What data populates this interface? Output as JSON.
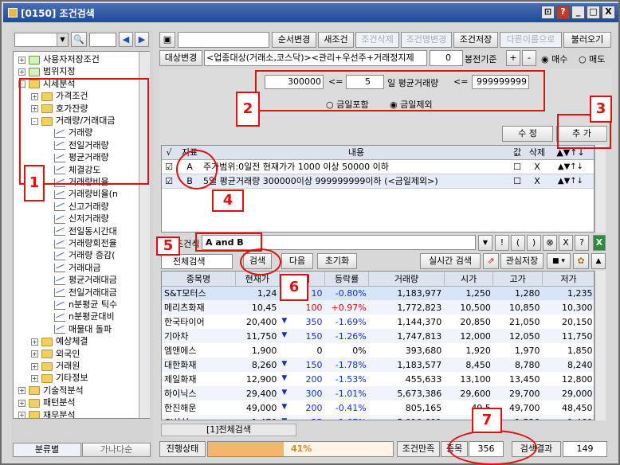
{
  "window": {
    "title": "[0150] 조건검색"
  },
  "left": {
    "search_placeholder": "",
    "tree": [
      {
        "label": "사용자저장조건"
      },
      {
        "label": "범위지정"
      },
      {
        "label": "시세분석"
      },
      {
        "label": "가격조건"
      },
      {
        "label": "호가잔량"
      },
      {
        "label": "거래량/거래대금"
      },
      {
        "label": "거래량"
      },
      {
        "label": "전일거래량"
      },
      {
        "label": "평균거래량"
      },
      {
        "label": "체결강도"
      },
      {
        "label": "거래량비율"
      },
      {
        "label": "거래량비율(n"
      },
      {
        "label": "신고거래량"
      },
      {
        "label": "신저거래량"
      },
      {
        "label": "전일동시간대"
      },
      {
        "label": "거래량회전율"
      },
      {
        "label": "거래량 증감("
      },
      {
        "label": "거래대금"
      },
      {
        "label": "평균거래대금"
      },
      {
        "label": "전일거래대금"
      },
      {
        "label": "n분평균 틱수"
      },
      {
        "label": "n분평균대비"
      },
      {
        "label": "매물대 돌파"
      },
      {
        "label": "예상체결"
      },
      {
        "label": "외국인"
      },
      {
        "label": "거래원"
      },
      {
        "label": "기타정보"
      },
      {
        "label": "기술적분석"
      },
      {
        "label": "패턴분석"
      },
      {
        "label": "재무분석"
      }
    ],
    "tab_category": "분류별",
    "tab_alpha": "가나다순"
  },
  "toolbar": {
    "save_change": "순서변경",
    "new_cond": "새조건",
    "cond_delete": "조건삭제",
    "name_change": "조건명변경",
    "cond_save": "조건저장",
    "save_as": "다른이름으로",
    "load": "불러오기"
  },
  "target": {
    "label": "대상변경",
    "value": "<업종대상(거래소,코스닥)><관리+우선주+거래정지제",
    "bong_value": "0",
    "bong_label": "봉전기준",
    "plus": "+",
    "minus": "-",
    "buy": "매수",
    "sell": "매도"
  },
  "condition": {
    "min_value": "300000",
    "op1": "<=",
    "days": "5",
    "days_label": "일 평균거래량",
    "op2": "<=",
    "max_value": "999999999",
    "radio_include": "금일포함",
    "radio_exclude": "금일제외",
    "edit_btn": "수  정",
    "add_btn": "추  가"
  },
  "cond_table": {
    "headers": {
      "check": "√",
      "index": "지표",
      "content": "내용",
      "value": "값",
      "delete": "삭제"
    },
    "rows": [
      {
        "idx": "A",
        "text": "주가범위:0일전 현재가가 1000 이상 50000 이하",
        "del": "X"
      },
      {
        "idx": "B",
        "text": "5일 평균거래량 300000이상 999999999이하 (<금일제외>)",
        "del": "X"
      }
    ]
  },
  "logic": {
    "label": "조건식",
    "expr": "A and B",
    "ops": [
      "!",
      "(",
      ")",
      "⊗",
      "X",
      "?"
    ]
  },
  "search_bar": {
    "scope": "전체검색",
    "search": "검색",
    "next": "다음",
    "reset": "초기화",
    "realtime": "실시간 검색",
    "watch_save": "관심저장"
  },
  "results": {
    "headers": [
      "종목명",
      "현재가",
      "대비",
      "등락률",
      "거래량",
      "시가",
      "고가",
      "저가"
    ],
    "rows": [
      {
        "name": "S&T모터스",
        "price": "1,24",
        "sign": "",
        "chg": "10",
        "rate": "-0.80%",
        "vol": "1,183,977",
        "open": "1,250",
        "high": "1,280",
        "low": "1,235",
        "dir": "dn"
      },
      {
        "name": "메리츠화재",
        "price": "10,45",
        "sign": "",
        "chg": "100",
        "rate": "+0.97%",
        "vol": "1,772,823",
        "open": "10,500",
        "high": "10,850",
        "low": "10,300",
        "dir": "up"
      },
      {
        "name": "한국타이어",
        "price": "20,400",
        "sign": "▼",
        "chg": "350",
        "rate": "-1.69%",
        "vol": "1,144,370",
        "open": "20,850",
        "high": "21,050",
        "low": "20,150",
        "dir": "dn"
      },
      {
        "name": "기아차",
        "price": "11,750",
        "sign": "▼",
        "chg": "150",
        "rate": "-1.26%",
        "vol": "1,747,813",
        "open": "12,000",
        "high": "12,050",
        "low": "11,750",
        "dir": "dn"
      },
      {
        "name": "엠앤에스",
        "price": "1,900",
        "sign": "",
        "chg": "0",
        "rate": "0%",
        "vol": "393,680",
        "open": "1,920",
        "high": "1,970",
        "low": "1,850",
        "dir": ""
      },
      {
        "name": "대한화재",
        "price": "8,260",
        "sign": "▼",
        "chg": "150",
        "rate": "-1.78%",
        "vol": "1,183,577",
        "open": "8,450",
        "high": "8,780",
        "low": "8,240",
        "dir": "dn"
      },
      {
        "name": "제일화재",
        "price": "12,900",
        "sign": "▼",
        "chg": "200",
        "rate": "-1.53%",
        "vol": "455,633",
        "open": "13,100",
        "high": "13,450",
        "low": "12,800",
        "dir": "dn"
      },
      {
        "name": "하이닉스",
        "price": "29,400",
        "sign": "▼",
        "chg": "300",
        "rate": "-1.01%",
        "vol": "5,673,386",
        "open": "29,600",
        "high": "29,700",
        "low": "29,000",
        "dir": "dn"
      },
      {
        "name": "한진해운",
        "price": "49,000",
        "sign": "▼",
        "chg": "200",
        "rate": "-0.41%",
        "vol": "805,165",
        "open": "49,5",
        "high": "49,700",
        "low": "48,450",
        "dir": "dn"
      },
      {
        "name": "CJ삼성",
        "price": "1,470",
        "sign": "▼",
        "chg": "25",
        "rate": "-1.67%",
        "vol": "5,010,691",
        "open": "1,",
        "high": "1,520",
        "low": "1,460",
        "dir": "dn"
      }
    ],
    "tab": "[1]전체검색"
  },
  "status": {
    "progress_label": "진행상태",
    "progress_percent": 41,
    "progress_text": "41%",
    "match_label": "조건만족",
    "items_label": "종목",
    "items_count": "356",
    "result_label": "검색결과",
    "result_count": "149"
  },
  "annotations": [
    "1",
    "2",
    "3",
    "4",
    "5",
    "6",
    "7"
  ],
  "colors": {
    "annotation": "#e01010",
    "up": "#d01010",
    "down": "#1030c0",
    "progress": "#f3b66a"
  }
}
